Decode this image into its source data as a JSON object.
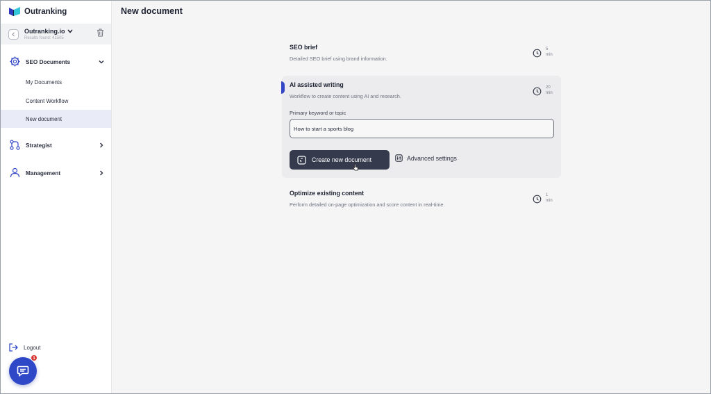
{
  "app": {
    "name": "Outranking"
  },
  "workspace": {
    "name": "Outranking.io",
    "results": "Results found: 41505"
  },
  "page": {
    "title": "New document"
  },
  "sidebar": {
    "seo_documents": {
      "label": "SEO Documents",
      "children": [
        "My Documents",
        "Content Workflow",
        "New document"
      ],
      "active_child": "New document"
    },
    "strategist": {
      "label": "Strategist"
    },
    "management": {
      "label": "Management"
    },
    "logout": {
      "label": "Logout"
    }
  },
  "chat": {
    "badge_count": "1"
  },
  "options": [
    {
      "title": "SEO brief",
      "description": "Detailed SEO brief using brand information.",
      "duration_value": "5",
      "duration_unit": "min"
    },
    {
      "title": "AI assisted writing",
      "description": "Workflow to create content using AI and research.",
      "duration_value": "20",
      "duration_unit": "min"
    },
    {
      "title": "Optimize existing content",
      "description": "Perform detailed on-page optimization and score content in real-time.",
      "duration_value": "1",
      "duration_unit": "min"
    }
  ],
  "ai_form": {
    "keyword_label": "Primary keyword or topic",
    "keyword_value": "How to start a sports blog",
    "create_button": "Create new document",
    "advanced_button": "Advanced settings"
  },
  "colors": {
    "accent": "#3346c6",
    "primary_button": "#353b4d",
    "chat": "#2f48c8",
    "badge": "#d8352e"
  }
}
